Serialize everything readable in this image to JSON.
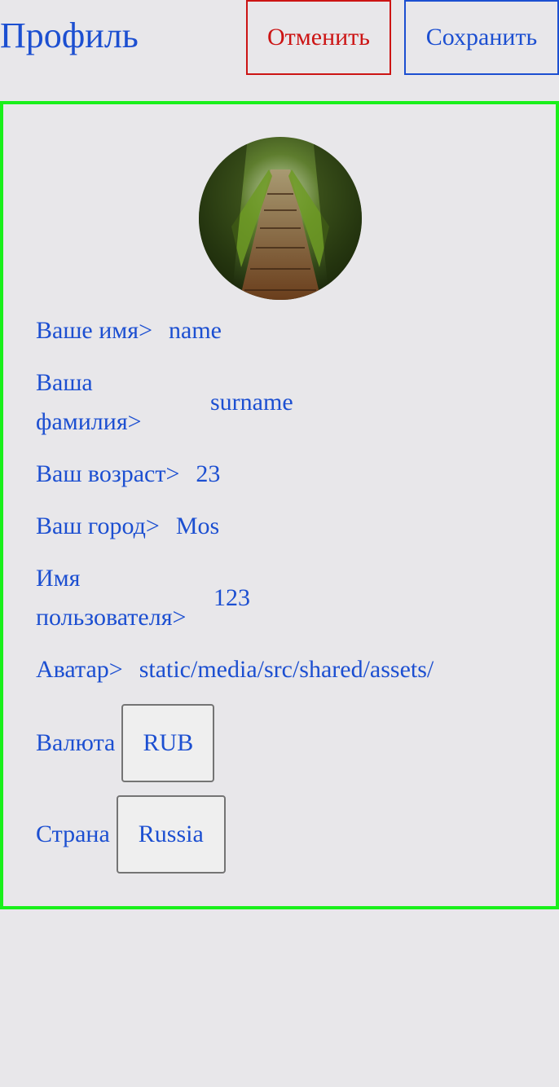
{
  "header": {
    "title": "Профиль",
    "cancel_label": "Отменить",
    "save_label": "Сохранить"
  },
  "form": {
    "name_label": "Ваше имя>",
    "name_value": "name",
    "surname_label": "Ваша фамилия>",
    "surname_value": "surname",
    "age_label": "Ваш возраст>",
    "age_value": "23",
    "city_label": "Ваш город>",
    "city_value": "Mos",
    "username_label": "Имя пользователя>",
    "username_value": "123",
    "avatar_label": "Аватар>",
    "avatar_value": "static/media/src/shared/assets/",
    "currency_label": "Валюта",
    "currency_value": "RUB",
    "country_label": "Страна",
    "country_value": "Russia"
  },
  "colors": {
    "text": "#1c4fd1",
    "cancel": "#cc1414",
    "card_border": "#19f01a",
    "background": "#e8e7ea"
  }
}
